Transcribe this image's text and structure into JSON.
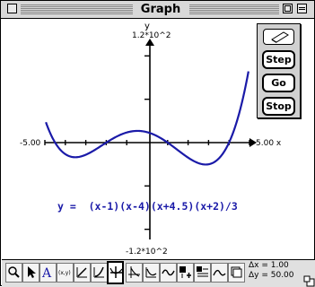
{
  "window": {
    "title": "Graph"
  },
  "plot": {
    "y_max_label": "1.2*10^2",
    "y_min_label": "-1.2*10^2",
    "x_min_label": "-5.00",
    "x_max_label": "5.00 x",
    "y_axis_label": "y",
    "equation": "y =  (x-1)(x-4)(x+4.5)(x+2)/3",
    "curve_color": "#1a1aa8",
    "equation_color": "#1a1aa8"
  },
  "chart_data": {
    "type": "line",
    "title": "",
    "xlabel": "x",
    "ylabel": "y",
    "xlim": [
      -5,
      5
    ],
    "ylim": [
      -120,
      120
    ],
    "function": "(x-1)(x-4)(x+4.5)(x+2)/3",
    "series": [
      {
        "name": "y =  (x-1)(x-4)(x+4.5)(x+2)/3",
        "x": [
          -4.5,
          -4.0,
          -3.5,
          -3.0,
          -2.5,
          -2.0,
          -1.5,
          -1.0,
          -0.5,
          0.0,
          0.5,
          1.0,
          1.5,
          2.0,
          2.5,
          3.0,
          3.5,
          4.0,
          4.5,
          5.0
        ],
        "y": [
          0,
          -10,
          -15,
          -16.0,
          -13.5,
          0,
          3.5,
          11.7,
          16.3,
          24,
          21.3,
          0,
          -15.3,
          -29.3,
          -37.1,
          -33.3,
          -20.3,
          0,
          26.0,
          77.3
        ]
      }
    ]
  },
  "palette": {
    "step_label": "Step",
    "go_label": "Go",
    "stop_label": "Stop"
  },
  "toolbar": {
    "tools": [
      "magnifier-icon",
      "arrow-pointer-icon",
      "text-tool-icon",
      "xy-readout-icon",
      "line-tool-icon",
      "curve-tool-icon",
      "axes-tool-icon",
      "slope-tool-icon",
      "derivative-tool-icon",
      "integral-tool-icon",
      "sine-tool-icon",
      "plus-tool-icon",
      "table-tool-icon",
      "wave-tool-icon",
      "stack-tool-icon"
    ],
    "dx_label": "Δx = 1.00",
    "dy_label": "Δy = 50.00"
  }
}
